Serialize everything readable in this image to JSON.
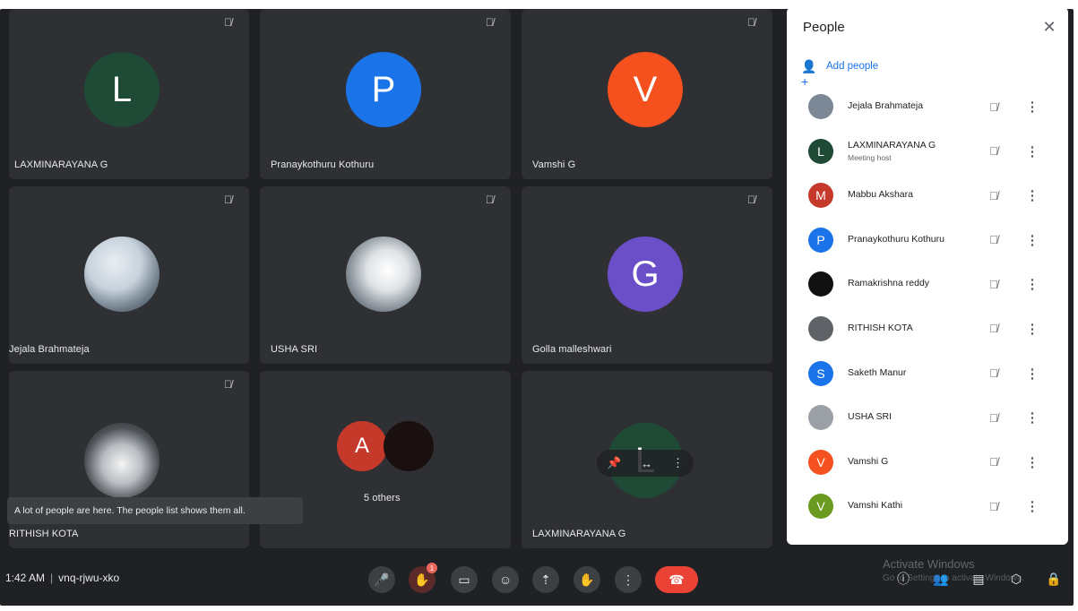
{
  "tiles": [
    {
      "initial": "L",
      "color": "#1e4a36",
      "name": "LAXMINARAYANA G"
    },
    {
      "initial": "P",
      "color": "#1a73e8",
      "name": "Pranaykothuru Kothuru"
    },
    {
      "initial": "V",
      "color": "#f4511e",
      "name": "Vamshi G"
    },
    {
      "initial": "",
      "color": "#6d7c88",
      "name": "Jejala Brahmateja"
    },
    {
      "initial": "",
      "color": "#8a939b",
      "name": "USHA SRI"
    },
    {
      "initial": "G",
      "color": "#6a4fc8",
      "name": "Golla malleshwari"
    },
    {
      "initial": "",
      "color": "#4d5257",
      "name": "RITHISH KOTA"
    },
    {
      "initial": "A",
      "color": "#c5392a",
      "name": "",
      "others_label": "5 others"
    },
    {
      "initial": "L",
      "color": "#1e4a36",
      "name": "LAXMINARAYANA G"
    }
  ],
  "tooltip": "A lot of people are here. The people list shows them all.",
  "bottombar": {
    "time": "1:42 AM",
    "separator": "|",
    "meeting_code": "vnq-rjwu-xko",
    "hand_badge": "1",
    "watermark_title": "Activate Windows",
    "watermark_sub": "Go to Settings to activate Windows."
  },
  "people_panel": {
    "title": "People",
    "add_people": "Add people",
    "participants": [
      {
        "name": "Jejala Brahmateja",
        "initial": "",
        "color": "#7b8794",
        "sub": ""
      },
      {
        "name": "LAXMINARAYANA G",
        "initial": "L",
        "color": "#1e4a36",
        "sub": "Meeting host"
      },
      {
        "name": "Mabbu Akshara",
        "initial": "M",
        "color": "#c5392a",
        "sub": ""
      },
      {
        "name": "Pranaykothuru Kothuru",
        "initial": "P",
        "color": "#1a73e8",
        "sub": ""
      },
      {
        "name": "Ramakrishna reddy",
        "initial": "",
        "color": "#111111",
        "sub": ""
      },
      {
        "name": "RITHISH KOTA",
        "initial": "",
        "color": "#5f6368",
        "sub": ""
      },
      {
        "name": "Saketh Manur",
        "initial": "S",
        "color": "#1a73e8",
        "sub": ""
      },
      {
        "name": "USHA SRI",
        "initial": "",
        "color": "#9aa0a6",
        "sub": ""
      },
      {
        "name": "Vamshi G",
        "initial": "V",
        "color": "#f4511e",
        "sub": ""
      },
      {
        "name": "Vamshi Kathi",
        "initial": "V",
        "color": "#6a9a1f",
        "sub": ""
      }
    ]
  },
  "icons": {
    "mic_off": "mic-off-icon",
    "more": "more-vert-icon",
    "close": "close-icon",
    "add_person": "person-add-icon"
  }
}
